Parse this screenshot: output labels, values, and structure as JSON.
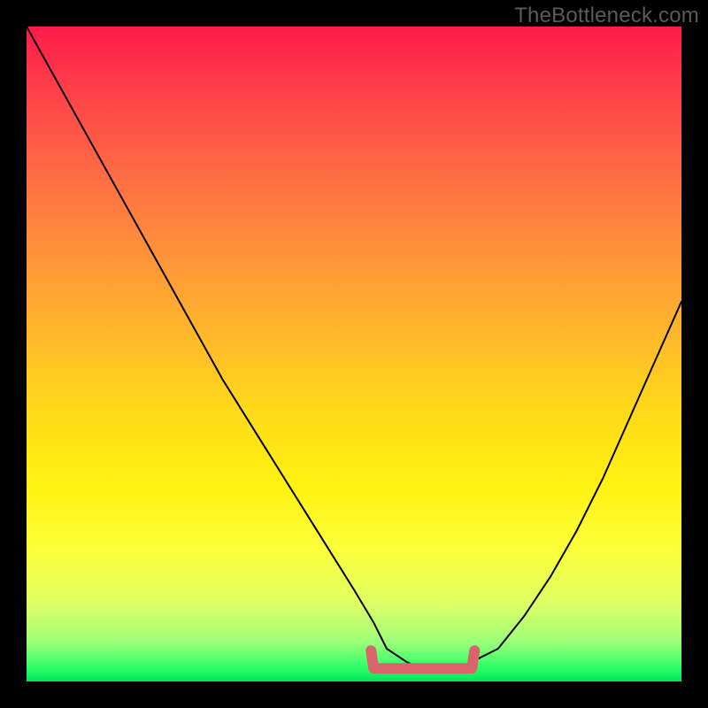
{
  "watermark": "TheBottleneck.com",
  "colors": {
    "highlight": "#d9646b",
    "curve": "#000000",
    "gradient_top": "#ff1a4a",
    "gradient_bottom": "#00e65a"
  },
  "chart_data": {
    "type": "line",
    "title": "",
    "xlabel": "",
    "ylabel": "",
    "xlim": [
      0,
      100
    ],
    "ylim": [
      0,
      100
    ],
    "grid": false,
    "legend_position": "none",
    "series": [
      {
        "name": "bottleneck_curve",
        "x": [
          0,
          5,
          10,
          15,
          20,
          25,
          30,
          35,
          40,
          45,
          50,
          53,
          55,
          58,
          60,
          62,
          64,
          66,
          68,
          72,
          76,
          80,
          84,
          88,
          92,
          96,
          100
        ],
        "y": [
          100,
          91,
          82,
          73,
          64,
          55,
          46,
          38,
          30,
          22,
          14,
          9,
          5,
          3,
          2,
          2,
          2,
          2,
          3,
          5,
          10,
          16,
          23,
          31,
          40,
          49,
          58
        ]
      }
    ],
    "annotations": [
      {
        "name": "optimal_flat_region",
        "x_start": 53,
        "x_end": 68,
        "y_level": 2,
        "color": "#d9646b"
      }
    ]
  }
}
